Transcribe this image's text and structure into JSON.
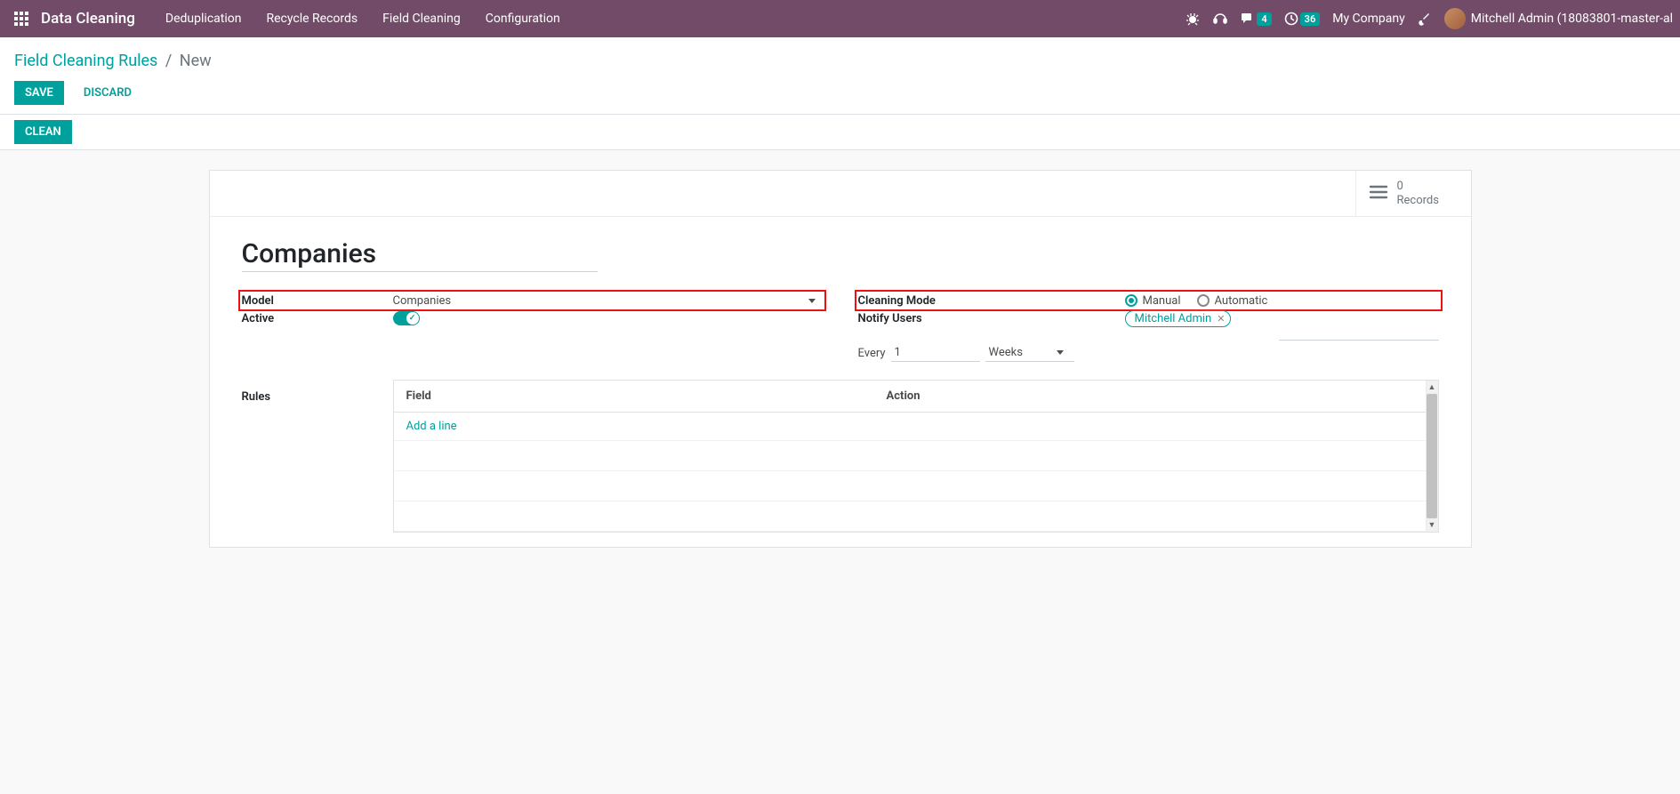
{
  "nav": {
    "brand": "Data Cleaning",
    "items": [
      "Deduplication",
      "Recycle Records",
      "Field Cleaning",
      "Configuration"
    ],
    "discuss_badge": "4",
    "activities_badge": "36",
    "company": "My Company",
    "user": "Mitchell Admin (18083801-master-al"
  },
  "breadcrumb": {
    "parent": "Field Cleaning Rules",
    "current": "New"
  },
  "buttons": {
    "save": "SAVE",
    "discard": "DISCARD",
    "clean": "CLEAN"
  },
  "stat": {
    "count": "0",
    "label": "Records"
  },
  "form": {
    "title": "Companies",
    "labels": {
      "model": "Model",
      "active": "Active",
      "cleaning_mode": "Cleaning Mode",
      "notify_users": "Notify Users",
      "rules": "Rules"
    },
    "model_value": "Companies",
    "mode_manual": "Manual",
    "mode_automatic": "Automatic",
    "notify_tag": "Mitchell Admin",
    "schedule_every": "Every",
    "schedule_value": "1",
    "schedule_unit": "Weeks",
    "table": {
      "col_field": "Field",
      "col_action": "Action",
      "add_line": "Add a line"
    }
  }
}
